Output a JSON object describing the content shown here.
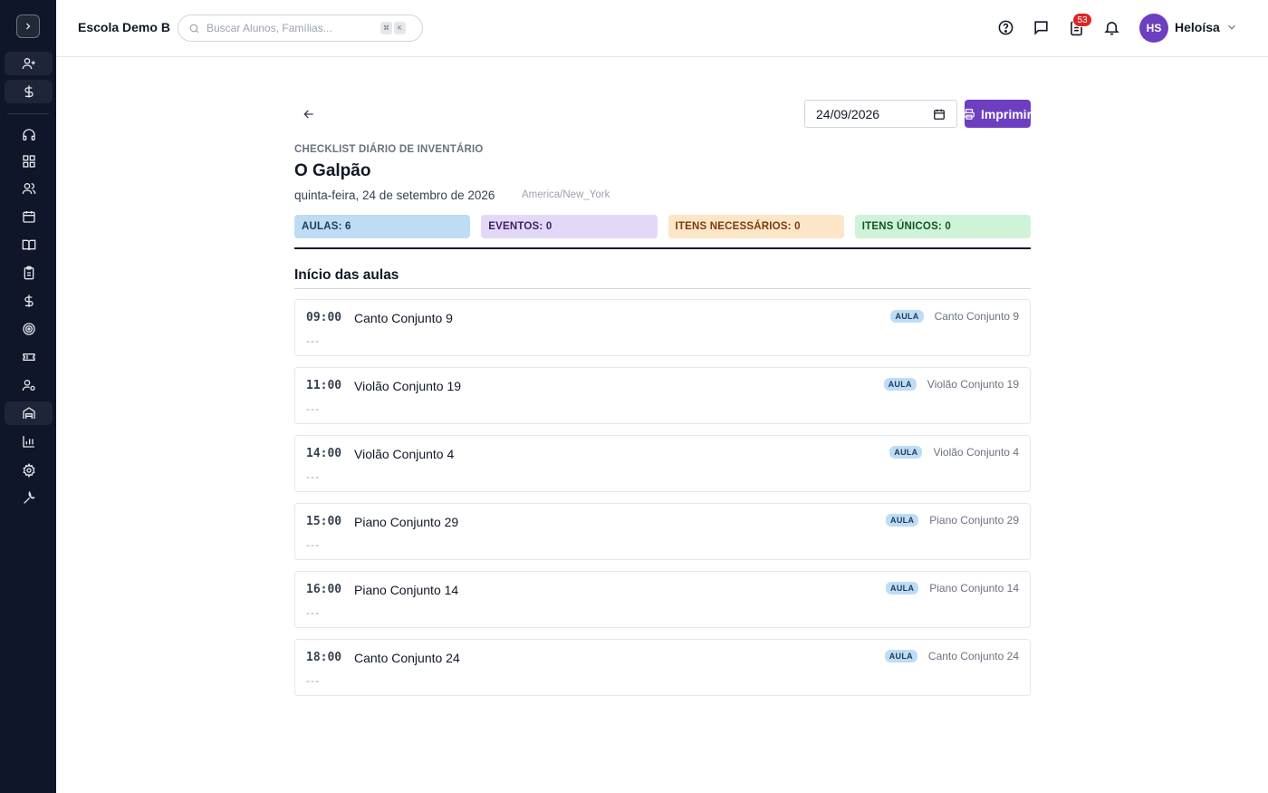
{
  "header": {
    "school_name": "Escola Demo B",
    "search_placeholder": "Buscar Alunos, Famílias...",
    "search_kbd": [
      "⌘",
      "K"
    ],
    "notification_count": "53",
    "user_initials": "HS",
    "user_name": "Heloísa"
  },
  "sidebar": {
    "items": [
      "add-user-icon",
      "dollar-icon",
      "headset-icon",
      "dashboard-icon",
      "users-icon",
      "calendar-icon",
      "book-icon",
      "clipboard-icon",
      "dollar-icon",
      "target-icon",
      "ticket-icon",
      "user-gear-icon",
      "building-icon",
      "chart-icon",
      "gear-icon",
      "wrench-icon"
    ]
  },
  "page": {
    "date_value": "24/09/2026",
    "print_label": "Imprimir",
    "eyebrow": "CHECKLIST DIÁRIO DE INVENTÁRIO",
    "title": "O Galpão",
    "subtitle": "quinta-feira, 24 de setembro de 2026",
    "timezone": "America/New_York",
    "pills": {
      "aulas": "AULAS: 6",
      "eventos": "EVENTOS: 0",
      "itens_necessarios": "ITENS NECESSÁRIOS: 0",
      "itens_unicos": "ITENS ÚNICOS: 0"
    },
    "section_title": "Início das aulas",
    "classes": [
      {
        "time": "09:00",
        "name": "Canto Conjunto 9",
        "tag": "AULA",
        "right_name": "Canto Conjunto 9",
        "notes": "---"
      },
      {
        "time": "11:00",
        "name": "Violão Conjunto 19",
        "tag": "AULA",
        "right_name": "Violão Conjunto 19",
        "notes": "---"
      },
      {
        "time": "14:00",
        "name": "Violão Conjunto 4",
        "tag": "AULA",
        "right_name": "Violão Conjunto 4",
        "notes": "---"
      },
      {
        "time": "15:00",
        "name": "Piano Conjunto 29",
        "tag": "AULA",
        "right_name": "Piano Conjunto 29",
        "notes": "---"
      },
      {
        "time": "16:00",
        "name": "Piano Conjunto 14",
        "tag": "AULA",
        "right_name": "Piano Conjunto 14",
        "notes": "---"
      },
      {
        "time": "18:00",
        "name": "Canto Conjunto 24",
        "tag": "AULA",
        "right_name": "Canto Conjunto 24",
        "notes": "---"
      }
    ]
  },
  "colors": {
    "sidebar_bg": "#0f1629",
    "accent": "#6d3fc0"
  }
}
